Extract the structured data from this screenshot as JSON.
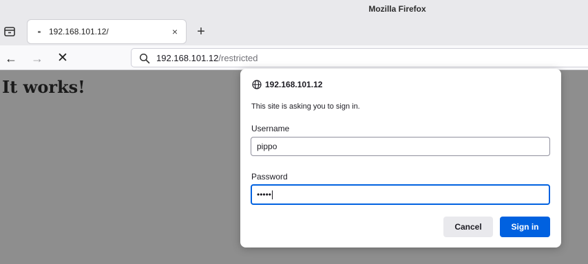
{
  "window": {
    "title": "Mozilla Firefox"
  },
  "tabs": [
    {
      "label": "192.168.101.12/",
      "close_glyph": "×",
      "loading": true
    }
  ],
  "toolbar": {
    "new_tab_glyph": "+",
    "back_glyph": "←",
    "forward_glyph": "→",
    "stop_glyph": "✕"
  },
  "urlbar": {
    "host": "192.168.101.12",
    "path": "/restricted",
    "icon": "search-icon"
  },
  "page": {
    "heading": "It works!"
  },
  "auth_dialog": {
    "origin": "192.168.101.12",
    "origin_icon": "globe-icon",
    "message": "This site is asking you to sign in.",
    "username_label": "Username",
    "username_value": "pippo",
    "password_label": "Password",
    "password_mask": "•••••",
    "cancel_label": "Cancel",
    "signin_label": "Sign in"
  },
  "colors": {
    "accent": "#0061e0",
    "page_background": "#8e8e8e",
    "chrome_background": "#e9e9ec"
  }
}
